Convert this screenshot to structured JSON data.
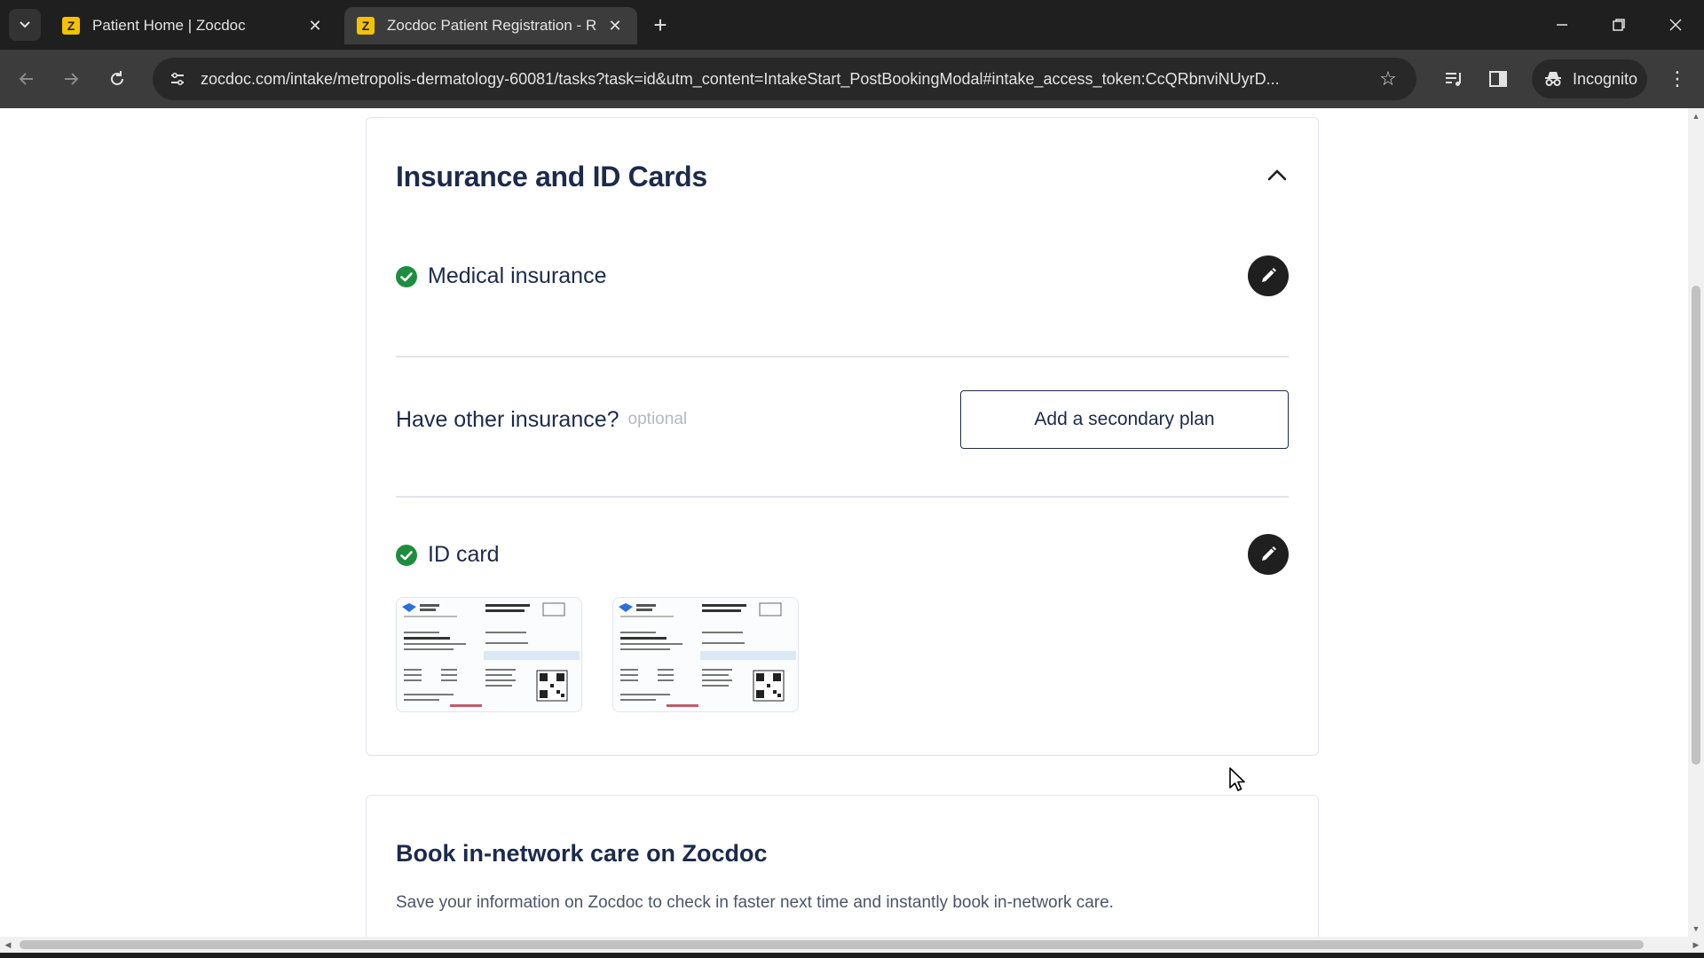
{
  "browser": {
    "tabs": [
      {
        "title": "Patient Home | Zocdoc",
        "favicon": "Z"
      },
      {
        "title": "Zocdoc Patient Registration - R",
        "favicon": "Z"
      }
    ],
    "url": "zocdoc.com/intake/metropolis-dermatology-60081/tasks?task=id&utm_content=IntakeStart_PostBookingModal#intake_access_token:CcQRbnviNUyrD...",
    "incognito_label": "Incognito"
  },
  "insurance_section": {
    "title": "Insurance and ID Cards",
    "medical_insurance": {
      "label": "Medical insurance",
      "status": "complete"
    },
    "other_insurance": {
      "question": "Have other insurance?",
      "optional_label": "optional",
      "button_label": "Add a secondary plan"
    },
    "id_card": {
      "label": "ID card",
      "status": "complete",
      "images": [
        "id-card-front",
        "id-card-back"
      ]
    }
  },
  "book_section": {
    "title": "Book in-network care on Zocdoc",
    "description": "Save your information on Zocdoc to check in faster next time and instantly book in-network care."
  },
  "colors": {
    "heading": "#1c2a4b",
    "check_green": "#1e8e3e",
    "edit_button": "#1f1f1f"
  }
}
